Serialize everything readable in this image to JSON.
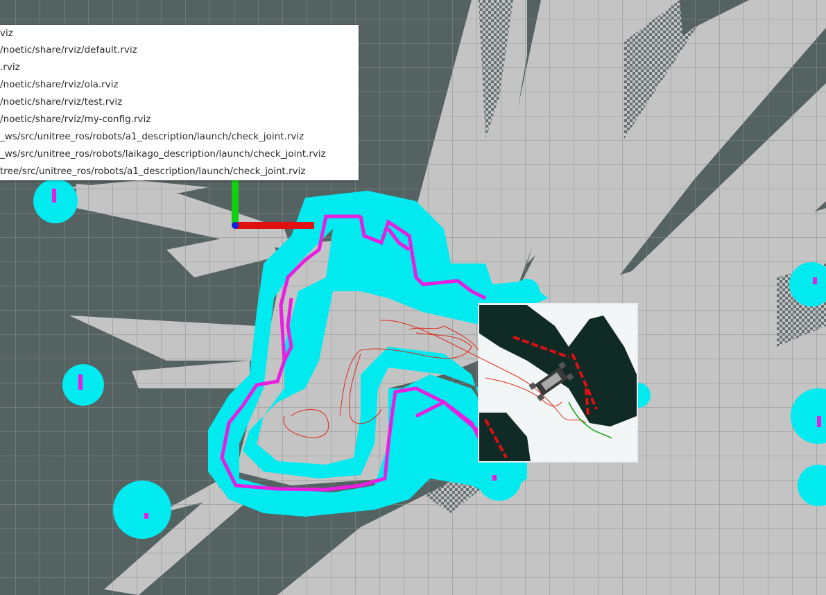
{
  "recent_configs_menu": {
    "items": [
      {
        "label": "viz"
      },
      {
        "label": "/noetic/share/rviz/default.rviz"
      },
      {
        "label": ".rviz"
      },
      {
        "label": "/noetic/share/rviz/ola.rviz"
      },
      {
        "label": "/noetic/share/rviz/test.rviz"
      },
      {
        "label": "/noetic/share/rviz/my-config.rviz"
      },
      {
        "label": "_ws/src/unitree_ros/robots/a1_description/launch/check_joint.rviz"
      },
      {
        "label": "_ws/src/unitree_ros/robots/laikago_description/launch/check_joint.rviz"
      },
      {
        "label": "tree/src/unitree_ros/robots/a1_description/launch/check_joint.rviz"
      }
    ]
  },
  "scene": {
    "colors": {
      "unknown": "#556262",
      "free": "#c4c4c4",
      "grid": "#8a8e8e",
      "inflation": "#00eaf0",
      "obstacle": "#e81ee0",
      "axis_x": "#e01010",
      "axis_y": "#10d010",
      "axis_z": "#1020e0",
      "local_costmap_bg": "#f3f6f6",
      "local_costmap_obstacle": "#102a26",
      "path": "#e02010",
      "plan": "#10a010",
      "robot": "#3a3a3a"
    },
    "icons": {
      "origin_axes": "tf-axes-icon",
      "robot": "robot-model-icon"
    }
  }
}
